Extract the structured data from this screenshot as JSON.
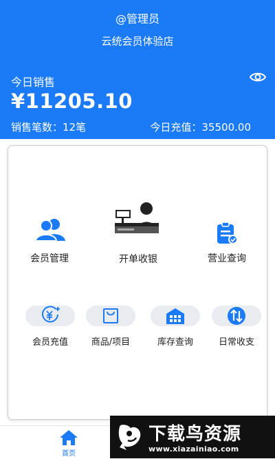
{
  "header": {
    "user_label": "@管理员",
    "store_name": "云统会员体验店",
    "sales_title": "今日销售",
    "sales_amount": "¥11205.10",
    "sales_count": "销售笔数：12笔",
    "recharge_today": "今日充值：35500.00",
    "eye_icon": "eye-icon"
  },
  "main_menu": [
    {
      "label": "会员管理",
      "icon": "members-icon"
    },
    {
      "label": "开单收银",
      "icon": "cashier-icon"
    },
    {
      "label": "营业查询",
      "icon": "report-icon"
    }
  ],
  "quick_menu": [
    {
      "label": "会员充值",
      "icon": "yen-recharge-icon"
    },
    {
      "label": "商品/项目",
      "icon": "shopping-bag-icon"
    },
    {
      "label": "库存查询",
      "icon": "warehouse-icon"
    },
    {
      "label": "日常收支",
      "icon": "transfer-icon"
    }
  ],
  "tabbar": {
    "home_label": "首页"
  },
  "watermark": {
    "title": "下载鸟资源",
    "url": "www.xiazainiao.com"
  },
  "colors": {
    "primary": "#1a7af8",
    "pill_bg": "#e8ebef"
  }
}
